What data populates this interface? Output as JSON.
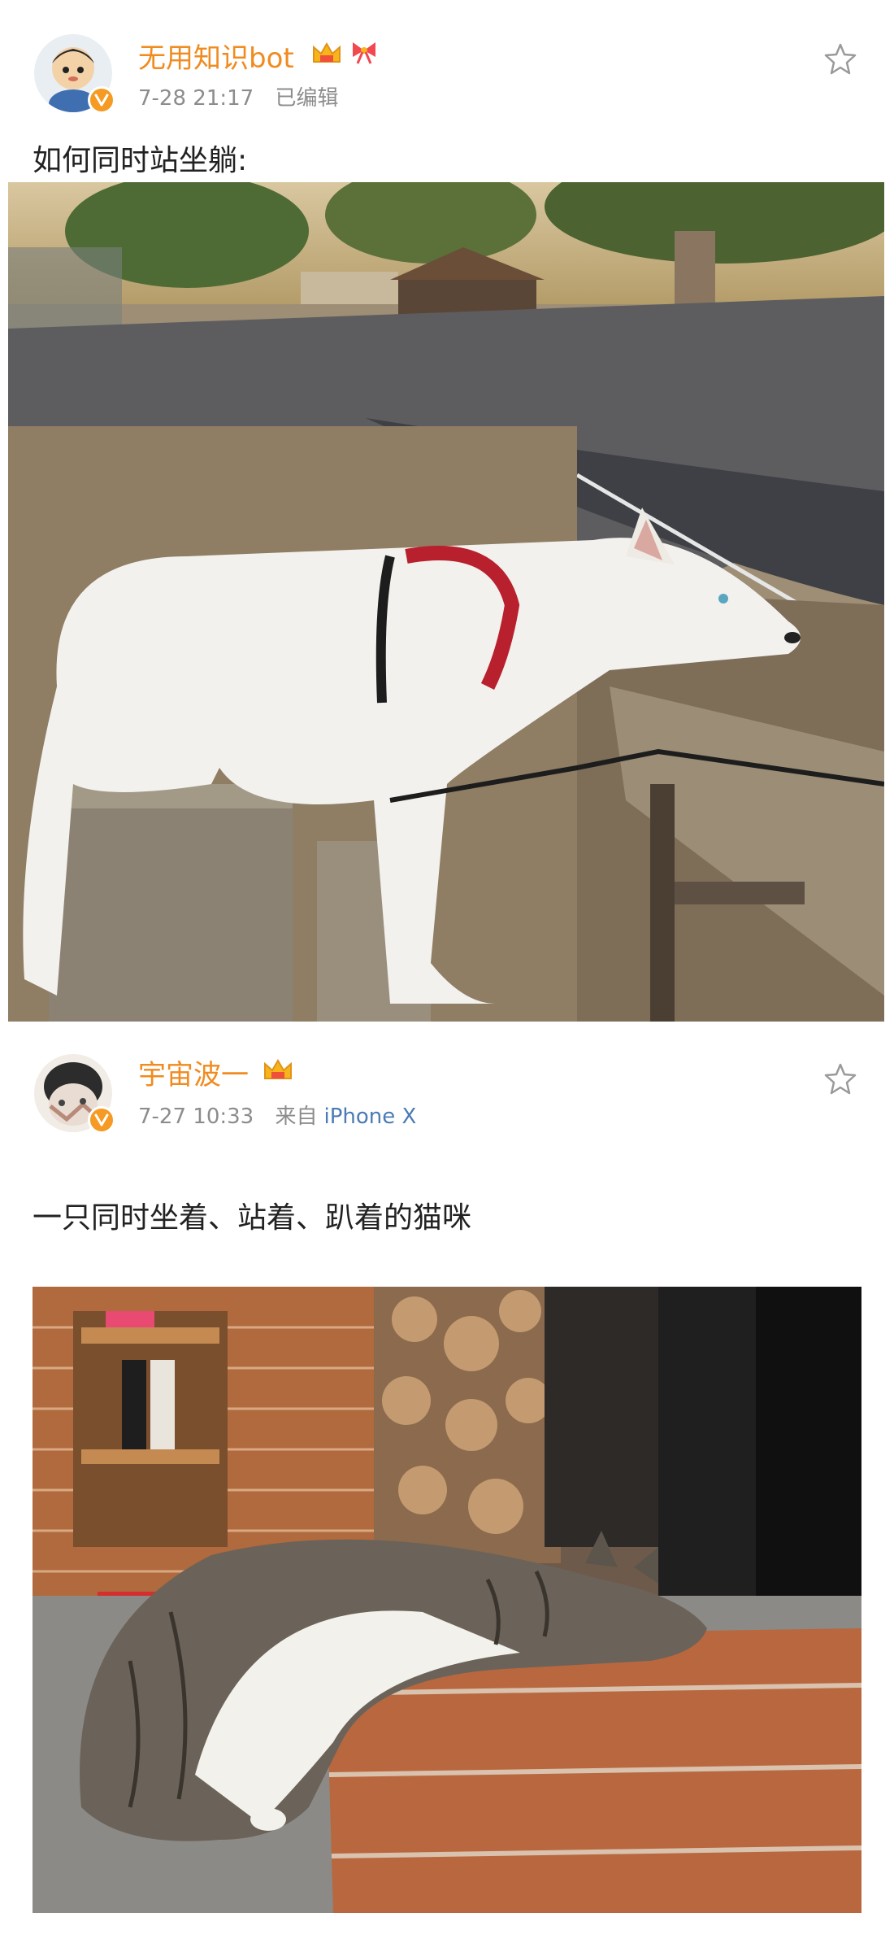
{
  "posts": [
    {
      "user": {
        "name": "无用知识bot"
      },
      "meta": {
        "date": "7-28 21:17",
        "edited": "已编辑",
        "source_prefix": "",
        "source": ""
      },
      "text": "如何同时站坐躺:",
      "icons": {
        "verified": "verified-v-icon",
        "badge_1": "vip-crown-icon",
        "badge_2": "bow-icon",
        "favorite": "star-outline-icon"
      }
    },
    {
      "user": {
        "name": "宇宙波一"
      },
      "meta": {
        "date": "7-27 10:33",
        "edited": "",
        "source_prefix": "来自",
        "source": "iPhone X"
      },
      "text": "一只同时坐着、站着、趴着的猫咪",
      "icons": {
        "verified": "verified-v-icon",
        "badge_1": "vip-crown-icon",
        "favorite": "star-outline-icon"
      }
    }
  ],
  "colors": {
    "username": "#f08b1f",
    "meta": "#8c8c8c",
    "source_link": "#4a7bb4",
    "verified": "#f59a23"
  }
}
